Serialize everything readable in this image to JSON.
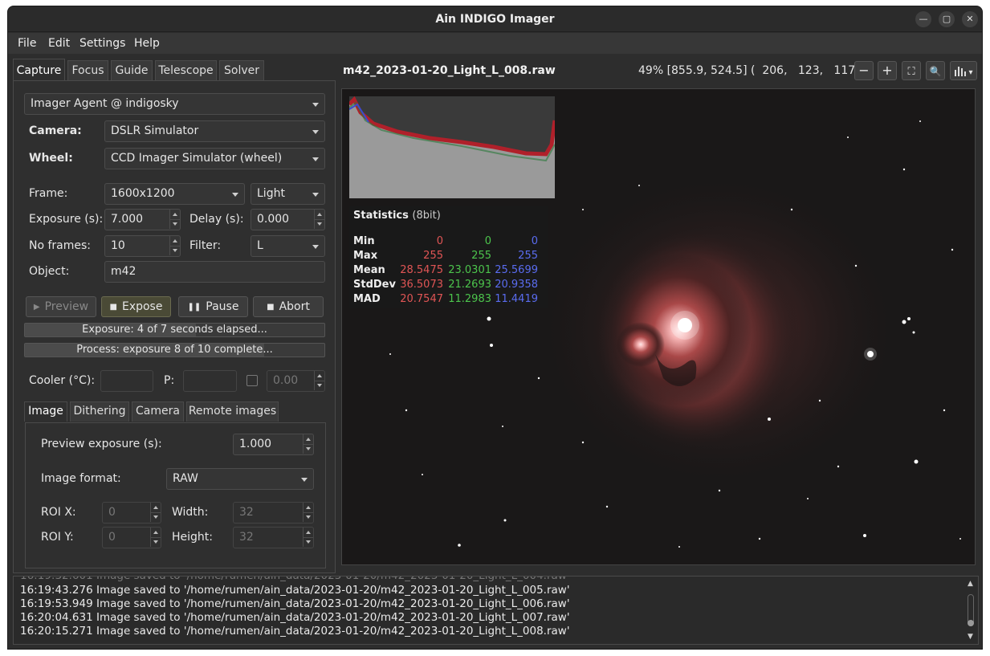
{
  "window": {
    "title": "Ain INDIGO Imager"
  },
  "menu": {
    "file": "File",
    "edit": "Edit",
    "settings": "Settings",
    "help": "Help"
  },
  "tabs": [
    "Capture",
    "Focus",
    "Guide",
    "Telescope",
    "Solver"
  ],
  "capture": {
    "agent": "Imager Agent @ indigosky",
    "camera_label": "Camera:",
    "camera": "DSLR Simulator",
    "wheel_label": "Wheel:",
    "wheel": "CCD Imager Simulator (wheel)",
    "frame_label": "Frame:",
    "frame": "1600x1200",
    "frame_type": "Light",
    "exposure_label": "Exposure (s):",
    "exposure": "7.000",
    "delay_label": "Delay (s):",
    "delay": "0.000",
    "frames_label": "No frames:",
    "frames": "10",
    "filter_label": "Filter:",
    "filter": "L",
    "object_label": "Object:",
    "object": "m42",
    "preview_btn": "Preview",
    "expose_btn": "Expose",
    "pause_btn": "Pause",
    "abort_btn": "Abort",
    "exposure_progress_text": "Exposure: 4 of 7 seconds elapsed...",
    "exposure_progress": 0.57,
    "process_progress_text": "Process: exposure 8 of 10 complete...",
    "process_progress": 0.8,
    "cooler_label": "Cooler (°C):",
    "cooler": "",
    "p_label": "P:",
    "p_value": "",
    "cooler_setpoint": "0.00"
  },
  "subtabs": [
    "Image",
    "Dithering",
    "Camera",
    "Remote images"
  ],
  "image_tab": {
    "preview_exposure_label": "Preview exposure (s):",
    "preview_exposure": "1.000",
    "format_label": "Image format:",
    "format": "RAW",
    "roi_x_label": "ROI X:",
    "roi_x": "0",
    "width_label": "Width:",
    "width": "32",
    "roi_y_label": "ROI Y:",
    "roi_y": "0",
    "height_label": "Height:",
    "height": "32"
  },
  "viewer": {
    "filename": "m42_2023-01-20_Light_L_008.raw",
    "coords": "49% [855.9, 524.5] (  206,   123,   117)",
    "zoom_out": "−",
    "zoom_in": "+",
    "fit": "⛶",
    "zoom": "🔍",
    "hist_menu": "▾"
  },
  "stats": {
    "title": "Statistics",
    "bits": "(8bit)",
    "rows": [
      {
        "label": "Min",
        "r": "0",
        "g": "0",
        "b": "0"
      },
      {
        "label": "Max",
        "r": "255",
        "g": "255",
        "b": "255"
      },
      {
        "label": "Mean",
        "r": "28.5475",
        "g": "23.0301",
        "b": "25.5699"
      },
      {
        "label": "StdDev",
        "r": "36.5073",
        "g": "21.2693",
        "b": "20.9358"
      },
      {
        "label": "MAD",
        "r": "20.7547",
        "g": "11.2983",
        "b": "11.4419"
      }
    ]
  },
  "colors": {
    "red": "#e05555",
    "green": "#4cc44c",
    "blue": "#5a6cf0"
  },
  "log": [
    "16:19:43.276 Image saved to '/home/rumen/ain_data/2023-01-20/m42_2023-01-20_Light_L_005.raw'",
    "16:19:53.949 Image saved to '/home/rumen/ain_data/2023-01-20/m42_2023-01-20_Light_L_006.raw'",
    "16:20:04.631 Image saved to '/home/rumen/ain_data/2023-01-20/m42_2023-01-20_Light_L_007.raw'",
    "16:20:15.271 Image saved to '/home/rumen/ain_data/2023-01-20/m42_2023-01-20_Light_L_008.raw'"
  ]
}
